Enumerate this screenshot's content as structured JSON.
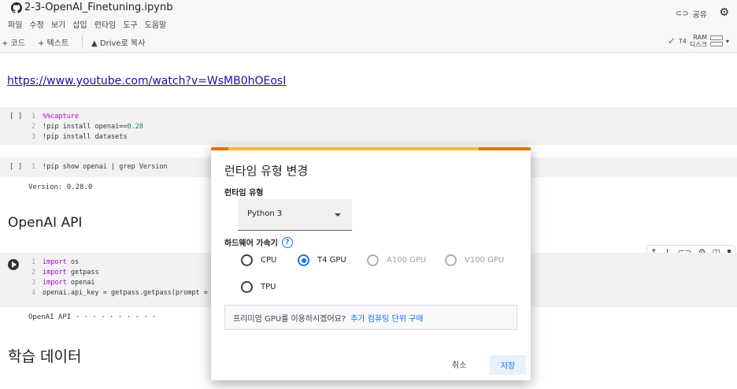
{
  "header": {
    "notebook_title": "2-3-OpenAI_Finetuning.ipynb",
    "menu": [
      "파일",
      "수정",
      "보기",
      "삽입",
      "런타임",
      "도구",
      "도움말"
    ],
    "share_label": "공유"
  },
  "toolbar": {
    "add_code": "+ 코드",
    "add_text": "+ 텍스트",
    "drive_copy": "Drive로 복사",
    "gpu_label": "T4",
    "ram_label": "RAM",
    "disk_label": "디스크"
  },
  "notebook": {
    "link": "https://www.youtube.com/watch?v=WsMB0hOEosI",
    "cell1": {
      "bracket": "[ ]",
      "lines": [
        {
          "n": "1",
          "parts": [
            {
              "t": "%%capture",
              "c": "kw"
            }
          ]
        },
        {
          "n": "2",
          "parts": [
            {
              "t": "!pip install openai==",
              "c": ""
            },
            {
              "t": "0.28",
              "c": "num"
            }
          ]
        },
        {
          "n": "3",
          "parts": [
            {
              "t": "!pip install datasets",
              "c": ""
            }
          ]
        }
      ]
    },
    "cell2": {
      "bracket": "[ ]",
      "lines": [
        {
          "n": "1",
          "parts": [
            {
              "t": "!pip show openai | grep Version",
              "c": ""
            }
          ]
        }
      ],
      "output": "Version: 0.28.0"
    },
    "heading_api": "OpenAI API",
    "cell3": {
      "lines": [
        {
          "n": "1",
          "parts": [
            {
              "t": "import",
              "c": "kw"
            },
            {
              "t": " os",
              "c": ""
            }
          ]
        },
        {
          "n": "2",
          "parts": [
            {
              "t": "import",
              "c": "kw"
            },
            {
              "t": " getpass",
              "c": ""
            }
          ]
        },
        {
          "n": "3",
          "parts": [
            {
              "t": "import",
              "c": "kw"
            },
            {
              "t": " openai",
              "c": ""
            }
          ]
        },
        {
          "n": "4",
          "parts": [
            {
              "t": "openai.api_key = getpass.getpass(prompt = ",
              "c": ""
            }
          ]
        }
      ],
      "output": "OpenAI API · · · · · · · · · ·"
    },
    "heading_data": "학습 데이터"
  },
  "dialog": {
    "title": "런타임 유형 변경",
    "runtime_label": "런타임 유형",
    "runtime_value": "Python 3",
    "hw_label": "하드웨어 가속기",
    "options": {
      "cpu": "CPU",
      "t4": "T4 GPU",
      "a100": "A100 GPU",
      "v100": "V100 GPU",
      "tpu": "TPU"
    },
    "selected": "T4 GPU",
    "promo_text": "프리미엄 GPU를 이용하시겠어요?",
    "promo_link": "추가 컴퓨팅 단위 구매",
    "cancel": "취소",
    "save": "저장"
  },
  "colors": {
    "accent": "#1a73e8",
    "dialog_bar": "#f5b642",
    "dialog_bar_dark": "#e37400"
  }
}
